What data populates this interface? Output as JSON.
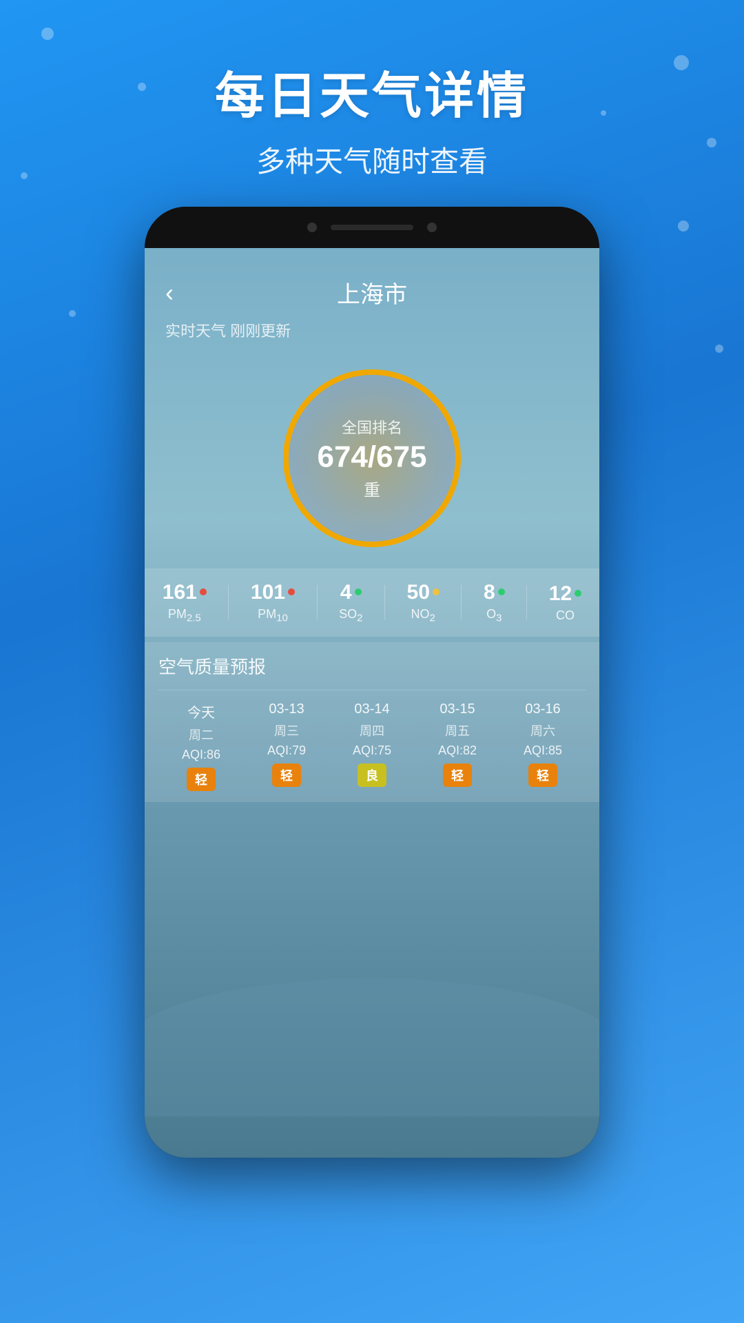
{
  "background": {
    "color_top": "#2196F3",
    "color_bottom": "#1565C0"
  },
  "top_section": {
    "main_title": "每日天气详情",
    "sub_title": "多种天气随时查看"
  },
  "app": {
    "header": {
      "back_label": "‹",
      "city_name": "上海市"
    },
    "update_info": "实时天气 刚刚更新",
    "aqi_circle": {
      "label": "全国排名",
      "value": "674/675",
      "status": "重"
    },
    "pollutants": [
      {
        "value": "161",
        "dot_color": "#e74c3c",
        "name": "PM₂.₅"
      },
      {
        "value": "101",
        "dot_color": "#e74c3c",
        "name": "PM₁₀"
      },
      {
        "value": "4",
        "dot_color": "#2ecc71",
        "name": "SO₂"
      },
      {
        "value": "50",
        "dot_color": "#f0c040",
        "name": "NO₂"
      },
      {
        "value": "8",
        "dot_color": "#2ecc71",
        "name": "O₃"
      },
      {
        "value": "12",
        "dot_color": "#2ecc71",
        "name": "CO"
      }
    ],
    "forecast": {
      "title": "空气质量预报",
      "items": [
        {
          "date": "今天",
          "day": "周二",
          "aqi": "AQI:86",
          "badge": "轻",
          "badge_type": "light"
        },
        {
          "date": "03-13",
          "day": "周三",
          "aqi": "AQI:79",
          "badge": "轻",
          "badge_type": "light"
        },
        {
          "date": "03-14",
          "day": "周四",
          "aqi": "AQI:75",
          "badge": "良",
          "badge_type": "good"
        },
        {
          "date": "03-15",
          "day": "周五",
          "aqi": "AQI:82",
          "badge": "轻",
          "badge_type": "light"
        },
        {
          "date": "03-16",
          "day": "周六",
          "aqi": "AQI:85",
          "badge": "轻",
          "badge_type": "light"
        }
      ]
    }
  }
}
